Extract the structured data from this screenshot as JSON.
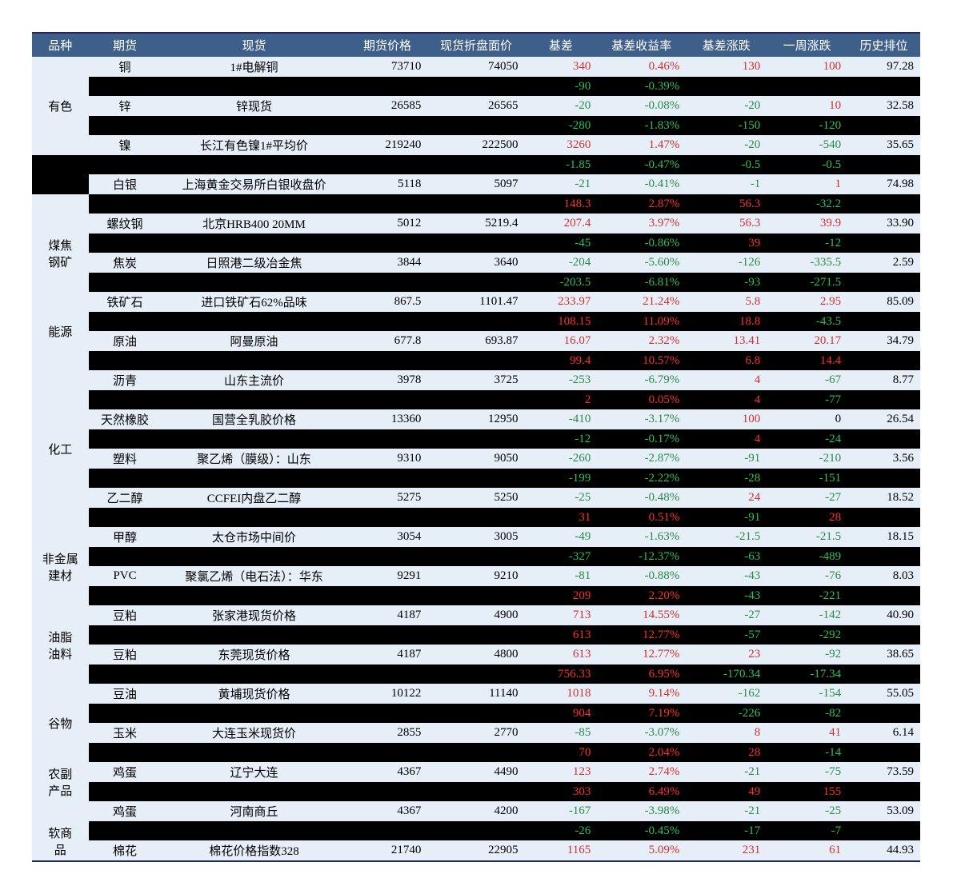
{
  "headers": [
    "品种",
    "期货",
    "现货",
    "期货价格",
    "现货折盘面价",
    "基差",
    "基差收益率",
    "基差涨跌",
    "一周涨跌",
    "历史排位"
  ],
  "groups": [
    {
      "category": "有色",
      "rows": [
        {
          "bg": "white",
          "futures": "铜",
          "spot": "1#电解铜",
          "fp": "73710",
          "sp": "74050",
          "basis": "340",
          "basis_c": "pos",
          "yield": "0.46%",
          "yield_c": "pos",
          "chg": "130",
          "chg_c": "pos",
          "wk": "100",
          "wk_c": "pos",
          "rank": "97.28"
        },
        {
          "bg": "black",
          "futures": "",
          "spot": "",
          "fp": "",
          "sp": "",
          "basis": "-90",
          "basis_c": "neg",
          "yield": "-0.39%",
          "yield_c": "neg",
          "chg": "",
          "chg_c": "",
          "wk": "",
          "wk_c": "",
          "rank": ""
        },
        {
          "bg": "white",
          "futures": "锌",
          "spot": "锌现货",
          "fp": "26585",
          "sp": "26565",
          "basis": "-20",
          "basis_c": "neg",
          "yield": "-0.08%",
          "yield_c": "neg",
          "chg": "-20",
          "chg_c": "neg",
          "wk": "10",
          "wk_c": "pos",
          "rank": "32.58"
        },
        {
          "bg": "black",
          "futures": "",
          "spot": "",
          "fp": "",
          "sp": "",
          "basis": "-280",
          "basis_c": "neg",
          "yield": "-1.83%",
          "yield_c": "neg",
          "chg": "-150",
          "chg_c": "neg",
          "wk": "-120",
          "wk_c": "neg",
          "rank": ""
        },
        {
          "bg": "white",
          "futures": "镍",
          "spot": "长江有色镍1#平均价",
          "fp": "219240",
          "sp": "222500",
          "basis": "3260",
          "basis_c": "pos",
          "yield": "1.47%",
          "yield_c": "pos",
          "chg": "-20",
          "chg_c": "neg",
          "wk": "-540",
          "wk_c": "neg",
          "rank": "35.65"
        }
      ]
    },
    {
      "category": "",
      "rows": [
        {
          "bg": "black",
          "futures": "",
          "spot": "",
          "fp": "",
          "sp": "",
          "basis": "-1.85",
          "basis_c": "neg",
          "yield": "-0.47%",
          "yield_c": "neg",
          "chg": "-0.5",
          "chg_c": "neg",
          "wk": "-0.5",
          "wk_c": "neg",
          "rank": ""
        },
        {
          "bg": "white",
          "futures": "白银",
          "spot": "上海黄金交易所白银收盘价",
          "fp": "5118",
          "sp": "5097",
          "basis": "-21",
          "basis_c": "neg",
          "yield": "-0.41%",
          "yield_c": "neg",
          "chg": "-1",
          "chg_c": "neg",
          "wk": "1",
          "wk_c": "pos",
          "rank": "74.98"
        }
      ]
    },
    {
      "category": "煤焦钢矿",
      "rows": [
        {
          "bg": "black",
          "futures": "",
          "spot": "",
          "fp": "",
          "sp": "",
          "basis": "148.3",
          "basis_c": "pos",
          "yield": "2.87%",
          "yield_c": "pos",
          "chg": "56.3",
          "chg_c": "pos",
          "wk": "-32.2",
          "wk_c": "neg",
          "rank": ""
        },
        {
          "bg": "white",
          "futures": "螺纹钢",
          "spot": "北京HRB400 20MM",
          "fp": "5012",
          "sp": "5219.4",
          "basis": "207.4",
          "basis_c": "pos",
          "yield": "3.97%",
          "yield_c": "pos",
          "chg": "56.3",
          "chg_c": "pos",
          "wk": "39.9",
          "wk_c": "pos",
          "rank": "33.90"
        },
        {
          "bg": "black",
          "futures": "",
          "spot": "",
          "fp": "",
          "sp": "",
          "basis": "-45",
          "basis_c": "neg",
          "yield": "-0.86%",
          "yield_c": "neg",
          "chg": "39",
          "chg_c": "pos",
          "wk": "-12",
          "wk_c": "neg",
          "rank": ""
        },
        {
          "bg": "white",
          "futures": "焦炭",
          "spot": "日照港二级冶金焦",
          "fp": "3844",
          "sp": "3640",
          "basis": "-204",
          "basis_c": "neg",
          "yield": "-5.60%",
          "yield_c": "neg",
          "chg": "-126",
          "chg_c": "neg",
          "wk": "-335.5",
          "wk_c": "neg",
          "rank": "2.59"
        },
        {
          "bg": "black",
          "futures": "",
          "spot": "",
          "fp": "",
          "sp": "",
          "basis": "-203.5",
          "basis_c": "neg",
          "yield": "-6.81%",
          "yield_c": "neg",
          "chg": "-93",
          "chg_c": "neg",
          "wk": "-271.5",
          "wk_c": "neg",
          "rank": ""
        },
        {
          "bg": "white",
          "futures": "铁矿石",
          "spot": "进口铁矿石62%品味",
          "fp": "867.5",
          "sp": "1101.47",
          "basis": "233.97",
          "basis_c": "pos",
          "yield": "21.24%",
          "yield_c": "pos",
          "chg": "5.8",
          "chg_c": "pos",
          "wk": "2.95",
          "wk_c": "pos",
          "rank": "85.09"
        }
      ]
    },
    {
      "category": "能源",
      "rows": [
        {
          "bg": "black",
          "futures": "",
          "spot": "",
          "fp": "",
          "sp": "",
          "basis": "108.15",
          "basis_c": "pos",
          "yield": "11.09%",
          "yield_c": "pos",
          "chg": "18.8",
          "chg_c": "pos",
          "wk": "-43.5",
          "wk_c": "neg",
          "rank": ""
        },
        {
          "bg": "white",
          "futures": "原油",
          "spot": "阿曼原油",
          "fp": "677.8",
          "sp": "693.87",
          "basis": "16.07",
          "basis_c": "pos",
          "yield": "2.32%",
          "yield_c": "pos",
          "chg": "13.41",
          "chg_c": "pos",
          "wk": "20.17",
          "wk_c": "pos",
          "rank": "34.79"
        }
      ]
    },
    {
      "category": "化工",
      "rows": [
        {
          "bg": "black",
          "futures": "",
          "spot": "",
          "fp": "",
          "sp": "",
          "basis": "99.4",
          "basis_c": "pos",
          "yield": "10.57%",
          "yield_c": "pos",
          "chg": "6.8",
          "chg_c": "pos",
          "wk": "14.4",
          "wk_c": "pos",
          "rank": ""
        },
        {
          "bg": "white",
          "futures": "沥青",
          "spot": "山东主流价",
          "fp": "3978",
          "sp": "3725",
          "basis": "-253",
          "basis_c": "neg",
          "yield": "-6.79%",
          "yield_c": "neg",
          "chg": "4",
          "chg_c": "pos",
          "wk": "-67",
          "wk_c": "neg",
          "rank": "8.77"
        },
        {
          "bg": "black",
          "futures": "",
          "spot": "",
          "fp": "",
          "sp": "",
          "basis": "2",
          "basis_c": "pos",
          "yield": "0.05%",
          "yield_c": "pos",
          "chg": "4",
          "chg_c": "pos",
          "wk": "-77",
          "wk_c": "neg",
          "rank": ""
        },
        {
          "bg": "white",
          "futures": "天然橡胶",
          "spot": "国营全乳胶价格",
          "fp": "13360",
          "sp": "12950",
          "basis": "-410",
          "basis_c": "neg",
          "yield": "-3.17%",
          "yield_c": "neg",
          "chg": "100",
          "chg_c": "pos",
          "wk": "0",
          "wk_c": "neutral",
          "rank": "26.54"
        },
        {
          "bg": "black",
          "futures": "",
          "spot": "",
          "fp": "",
          "sp": "",
          "basis": "-12",
          "basis_c": "neg",
          "yield": "-0.17%",
          "yield_c": "neg",
          "chg": "4",
          "chg_c": "pos",
          "wk": "-24",
          "wk_c": "neg",
          "rank": ""
        },
        {
          "bg": "white",
          "futures": "塑料",
          "spot": "聚乙烯（膜级）：山东",
          "fp": "9310",
          "sp": "9050",
          "basis": "-260",
          "basis_c": "neg",
          "yield": "-2.87%",
          "yield_c": "neg",
          "chg": "-91",
          "chg_c": "neg",
          "wk": "-210",
          "wk_c": "neg",
          "rank": "3.56"
        },
        {
          "bg": "black",
          "futures": "",
          "spot": "",
          "fp": "",
          "sp": "",
          "basis": "-199",
          "basis_c": "neg",
          "yield": "-2.22%",
          "yield_c": "neg",
          "chg": "-28",
          "chg_c": "neg",
          "wk": "-151",
          "wk_c": "neg",
          "rank": ""
        },
        {
          "bg": "white",
          "futures": "乙二醇",
          "spot": "CCFEI内盘乙二醇",
          "fp": "5275",
          "sp": "5250",
          "basis": "-25",
          "basis_c": "neg",
          "yield": "-0.48%",
          "yield_c": "neg",
          "chg": "24",
          "chg_c": "pos",
          "wk": "-27",
          "wk_c": "neg",
          "rank": "18.52"
        },
        {
          "bg": "black",
          "futures": "",
          "spot": "",
          "fp": "",
          "sp": "",
          "basis": "31",
          "basis_c": "pos",
          "yield": "0.51%",
          "yield_c": "pos",
          "chg": "-91",
          "chg_c": "neg",
          "wk": "28",
          "wk_c": "pos",
          "rank": ""
        },
        {
          "bg": "white",
          "futures": "甲醇",
          "spot": "太仓市场中间价",
          "fp": "3054",
          "sp": "3005",
          "basis": "-49",
          "basis_c": "neg",
          "yield": "-1.63%",
          "yield_c": "neg",
          "chg": "-21.5",
          "chg_c": "neg",
          "wk": "-21.5",
          "wk_c": "neg",
          "rank": "18.15"
        }
      ]
    },
    {
      "category": "非金属建材",
      "rows": [
        {
          "bg": "black",
          "futures": "",
          "spot": "",
          "fp": "",
          "sp": "",
          "basis": "-327",
          "basis_c": "neg",
          "yield": "-12.37%",
          "yield_c": "neg",
          "chg": "-63",
          "chg_c": "neg",
          "wk": "-489",
          "wk_c": "neg",
          "rank": ""
        },
        {
          "bg": "white",
          "futures": "PVC",
          "spot": "聚氯乙烯（电石法）：华东",
          "fp": "9291",
          "sp": "9210",
          "basis": "-81",
          "basis_c": "neg",
          "yield": "-0.88%",
          "yield_c": "neg",
          "chg": "-43",
          "chg_c": "neg",
          "wk": "-76",
          "wk_c": "neg",
          "rank": "8.03"
        }
      ]
    },
    {
      "category": "油脂油料",
      "rows": [
        {
          "bg": "black",
          "futures": "",
          "spot": "",
          "fp": "",
          "sp": "",
          "basis": "209",
          "basis_c": "pos",
          "yield": "2.20%",
          "yield_c": "pos",
          "chg": "-43",
          "chg_c": "neg",
          "wk": "-221",
          "wk_c": "neg",
          "rank": ""
        },
        {
          "bg": "white",
          "futures": "豆粕",
          "spot": "张家港现货价格",
          "fp": "4187",
          "sp": "4900",
          "basis": "713",
          "basis_c": "pos",
          "yield": "14.55%",
          "yield_c": "pos",
          "chg": "-27",
          "chg_c": "neg",
          "wk": "-142",
          "wk_c": "neg",
          "rank": "40.90"
        },
        {
          "bg": "black",
          "futures": "",
          "spot": "",
          "fp": "",
          "sp": "",
          "basis": "613",
          "basis_c": "pos",
          "yield": "12.77%",
          "yield_c": "pos",
          "chg": "-57",
          "chg_c": "neg",
          "wk": "-292",
          "wk_c": "neg",
          "rank": ""
        },
        {
          "bg": "white",
          "futures": "豆粕",
          "spot": "东莞现货价格",
          "fp": "4187",
          "sp": "4800",
          "basis": "613",
          "basis_c": "pos",
          "yield": "12.77%",
          "yield_c": "pos",
          "chg": "23",
          "chg_c": "pos",
          "wk": "-92",
          "wk_c": "neg",
          "rank": "38.65"
        },
        {
          "bg": "black",
          "futures": "",
          "spot": "",
          "fp": "",
          "sp": "",
          "basis": "756.33",
          "basis_c": "pos",
          "yield": "6.95%",
          "yield_c": "pos",
          "chg": "-170.34",
          "chg_c": "neg",
          "wk": "-17.34",
          "wk_c": "neg",
          "rank": ""
        },
        {
          "bg": "white",
          "futures": "豆油",
          "spot": "黄埔现货价格",
          "fp": "10122",
          "sp": "11140",
          "basis": "1018",
          "basis_c": "pos",
          "yield": "9.14%",
          "yield_c": "pos",
          "chg": "-162",
          "chg_c": "neg",
          "wk": "-154",
          "wk_c": "neg",
          "rank": "55.05"
        }
      ]
    },
    {
      "category": "谷物",
      "rows": [
        {
          "bg": "black",
          "futures": "",
          "spot": "",
          "fp": "",
          "sp": "",
          "basis": "904",
          "basis_c": "pos",
          "yield": "7.19%",
          "yield_c": "pos",
          "chg": "-226",
          "chg_c": "neg",
          "wk": "-82",
          "wk_c": "neg",
          "rank": ""
        },
        {
          "bg": "white",
          "futures": "玉米",
          "spot": "大连玉米现货价",
          "fp": "2855",
          "sp": "2770",
          "basis": "-85",
          "basis_c": "neg",
          "yield": "-3.07%",
          "yield_c": "neg",
          "chg": "8",
          "chg_c": "pos",
          "wk": "41",
          "wk_c": "pos",
          "rank": "6.14"
        }
      ]
    },
    {
      "category": "农副产品",
      "rows": [
        {
          "bg": "black",
          "futures": "",
          "spot": "",
          "fp": "",
          "sp": "",
          "basis": "70",
          "basis_c": "pos",
          "yield": "2.04%",
          "yield_c": "pos",
          "chg": "28",
          "chg_c": "pos",
          "wk": "-14",
          "wk_c": "neg",
          "rank": ""
        },
        {
          "bg": "white",
          "futures": "鸡蛋",
          "spot": "辽宁大连",
          "fp": "4367",
          "sp": "4490",
          "basis": "123",
          "basis_c": "pos",
          "yield": "2.74%",
          "yield_c": "pos",
          "chg": "-21",
          "chg_c": "neg",
          "wk": "-75",
          "wk_c": "neg",
          "rank": "73.59"
        },
        {
          "bg": "black",
          "futures": "",
          "spot": "",
          "fp": "",
          "sp": "",
          "basis": "303",
          "basis_c": "pos",
          "yield": "6.49%",
          "yield_c": "pos",
          "chg": "49",
          "chg_c": "pos",
          "wk": "155",
          "wk_c": "pos",
          "rank": ""
        },
        {
          "bg": "white",
          "futures": "鸡蛋",
          "spot": "河南商丘",
          "fp": "4367",
          "sp": "4200",
          "basis": "-167",
          "basis_c": "neg",
          "yield": "-3.98%",
          "yield_c": "neg",
          "chg": "-21",
          "chg_c": "neg",
          "wk": "-25",
          "wk_c": "neg",
          "rank": "53.09"
        }
      ]
    },
    {
      "category": "软商品",
      "rows": [
        {
          "bg": "black",
          "futures": "",
          "spot": "",
          "fp": "",
          "sp": "",
          "basis": "-26",
          "basis_c": "neg",
          "yield": "-0.45%",
          "yield_c": "neg",
          "chg": "-17",
          "chg_c": "neg",
          "wk": "-7",
          "wk_c": "neg",
          "rank": ""
        },
        {
          "bg": "white",
          "futures": "棉花",
          "spot": "棉花价格指数328",
          "fp": "21740",
          "sp": "22905",
          "basis": "1165",
          "basis_c": "pos",
          "yield": "5.09%",
          "yield_c": "pos",
          "chg": "231",
          "chg_c": "pos",
          "wk": "61",
          "wk_c": "pos",
          "rank": "44.93"
        }
      ]
    }
  ]
}
